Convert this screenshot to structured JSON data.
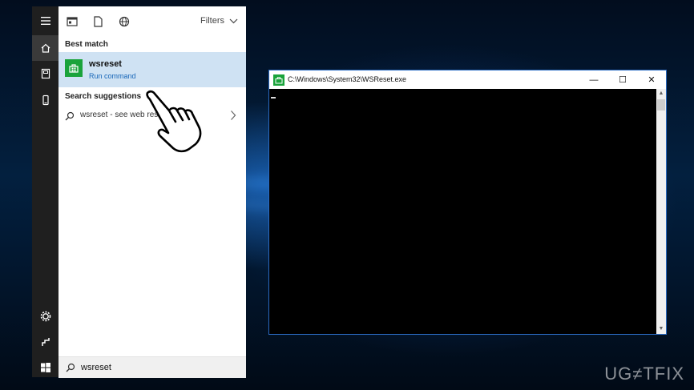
{
  "start_menu": {
    "filters_label": "Filters",
    "best_match_label": "Best match",
    "best_match_item": {
      "title": "wsreset",
      "subtitle": "Run command",
      "icon": "store-icon"
    },
    "search_suggestions_label": "Search suggestions",
    "suggestion": {
      "text": "wsreset - see web results"
    },
    "search_query": "wsreset"
  },
  "console_window": {
    "title": "C:\\Windows\\System32\\WSReset.exe",
    "minimize": "—",
    "maximize": "☐",
    "close": "✕"
  },
  "watermark": "UG≠TFIX",
  "colors": {
    "accent": "#1766b8",
    "selected_row": "#cfe2f3",
    "app_tile": "#1aa33b"
  }
}
